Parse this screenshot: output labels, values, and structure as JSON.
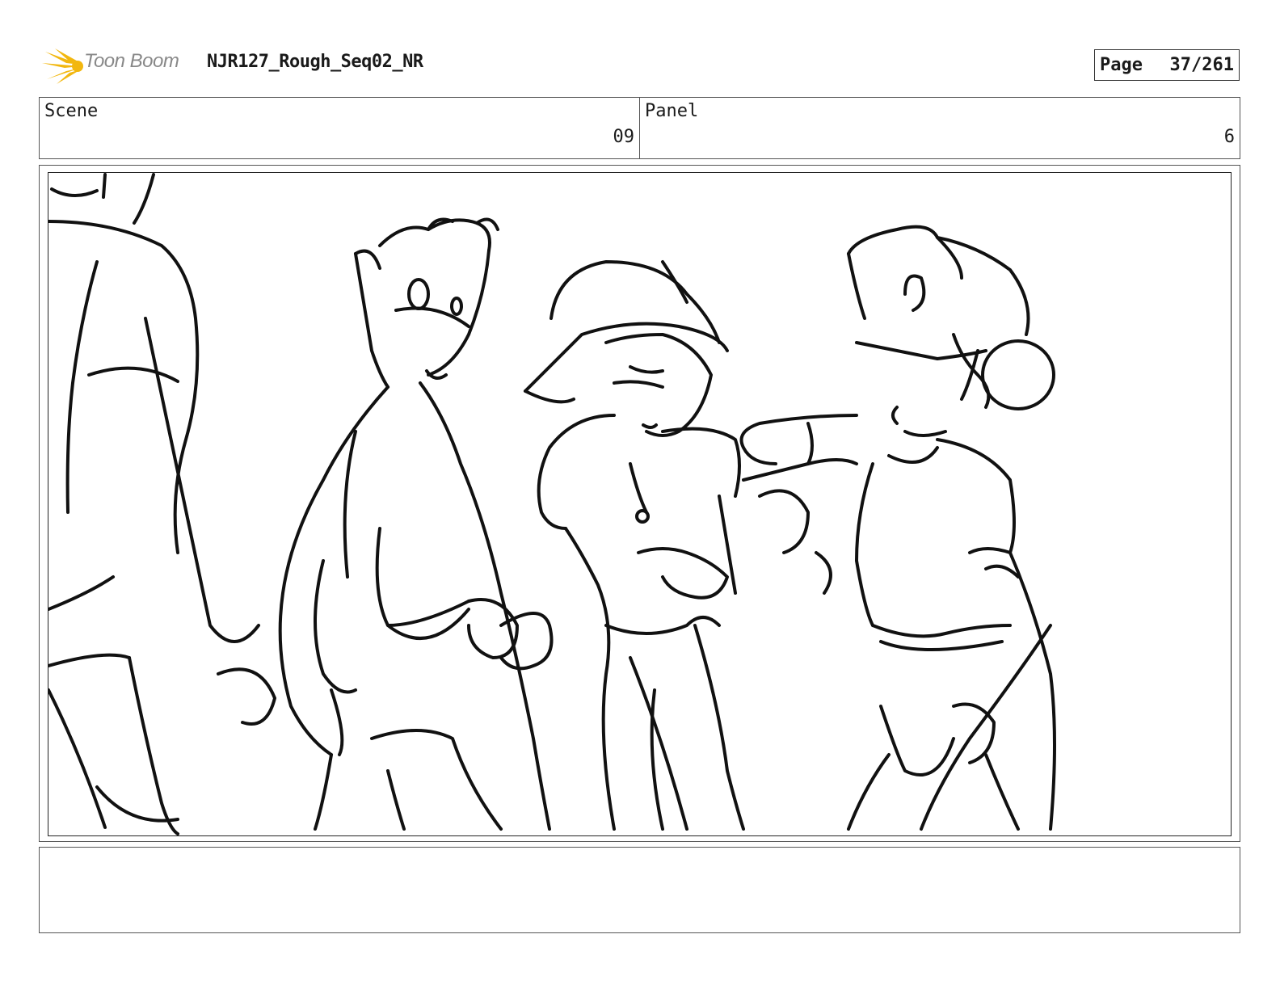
{
  "header": {
    "logo_text": "Toon Boom",
    "logo_icon": "toon-boom-burst-icon",
    "title": "NJR127_Rough_Seq02_NR",
    "page_label": "Page",
    "page_value": "37/261"
  },
  "info": {
    "scene_label": "Scene",
    "scene_value": "09",
    "panel_label": "Panel",
    "panel_value": "6"
  },
  "panel": {
    "drawing": "storyboard-sketch"
  },
  "notes": {
    "text": ""
  },
  "colors": {
    "logo_burst": "#f2b70f",
    "logo_text": "#888888",
    "ink": "#111111",
    "border": "#555555"
  }
}
